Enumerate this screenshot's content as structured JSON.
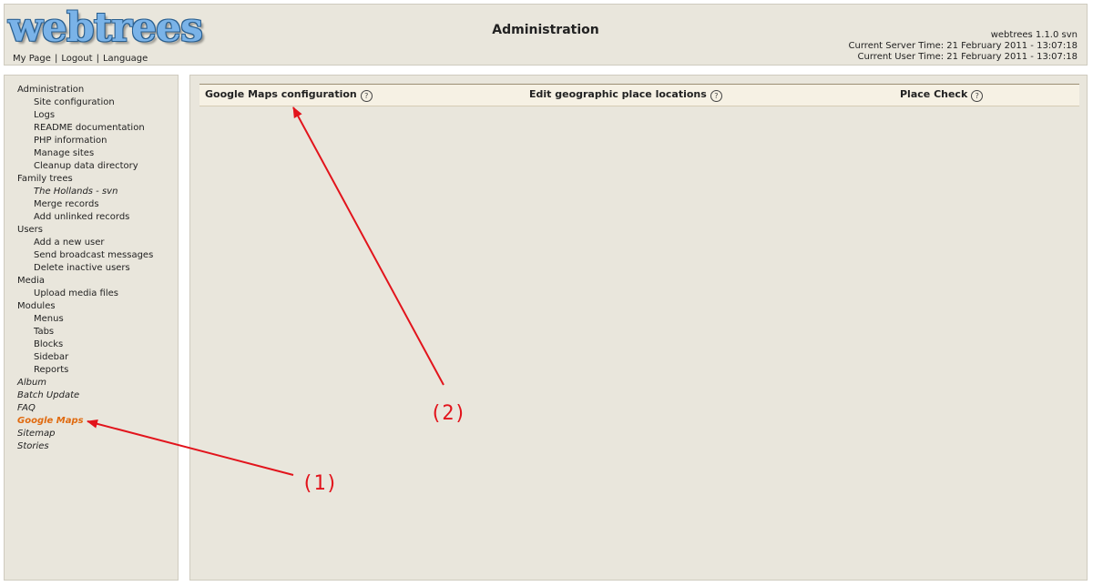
{
  "header": {
    "logo": "webtrees",
    "title": "Administration",
    "nav": [
      "My Page",
      "Logout",
      "Language"
    ],
    "version": "webtrees 1.1.0 svn",
    "server_time": "Current Server Time: 21 February 2011 - 13:07:18",
    "user_time": "Current User Time: 21 February 2011 - 13:07:18"
  },
  "sidebar": {
    "administration": {
      "label": "Administration",
      "items": [
        "Site configuration",
        "Logs",
        "README documentation",
        "PHP information",
        "Manage sites",
        "Cleanup data directory"
      ]
    },
    "family_trees": {
      "label": "Family trees",
      "items": [
        "The Hollands - svn",
        "Merge records",
        "Add unlinked records"
      ]
    },
    "users": {
      "label": "Users",
      "items": [
        "Add a new user",
        "Send broadcast messages",
        "Delete inactive users"
      ]
    },
    "media": {
      "label": "Media",
      "items": [
        "Upload media files"
      ]
    },
    "modules": {
      "label": "Modules",
      "items": [
        "Menus",
        "Tabs",
        "Blocks",
        "Sidebar",
        "Reports"
      ]
    },
    "module_links": [
      "Album",
      "Batch Update",
      "FAQ",
      "Google Maps",
      "Sitemap",
      "Stories"
    ],
    "active_color": "#e06a0f"
  },
  "tabs": [
    "Google Maps configuration",
    "Edit geographic place locations",
    "Place Check"
  ],
  "help_glyph": "?",
  "annotations": {
    "label1": "(1)",
    "label2": "(2)",
    "color": "#e2141c"
  }
}
